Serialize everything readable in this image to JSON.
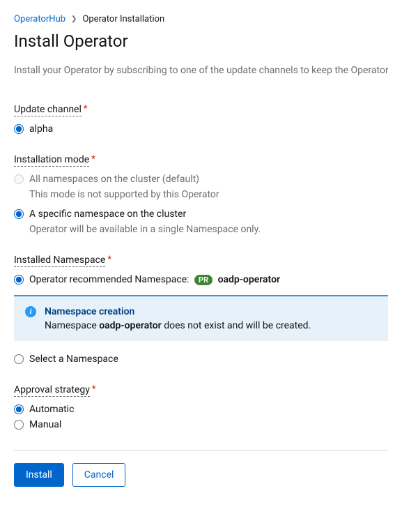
{
  "breadcrumb": {
    "link": "OperatorHub",
    "current": "Operator Installation"
  },
  "page": {
    "title": "Install Operator",
    "description": "Install your Operator by subscribing to one of the update channels to keep the Operator up to date."
  },
  "updateChannel": {
    "label": "Update channel",
    "options": {
      "alpha": "alpha"
    }
  },
  "installMode": {
    "label": "Installation mode",
    "allNs": {
      "label": "All namespaces on the cluster (default)",
      "help": "This mode is not supported by this Operator"
    },
    "specificNs": {
      "label": "A specific namespace on the cluster",
      "help": "Operator will be available in a single Namespace only."
    }
  },
  "installedNs": {
    "label": "Installed Namespace",
    "recommended": {
      "prefix": "Operator recommended Namespace:",
      "badge": "PR",
      "name": "oadp-operator"
    },
    "alert": {
      "title": "Namespace creation",
      "body_prefix": "Namespace ",
      "body_ns": "oadp-operator",
      "body_suffix": " does not exist and will be created."
    },
    "selectNs": "Select a Namespace"
  },
  "approval": {
    "label": "Approval strategy",
    "automatic": "Automatic",
    "manual": "Manual"
  },
  "buttons": {
    "install": "Install",
    "cancel": "Cancel"
  }
}
